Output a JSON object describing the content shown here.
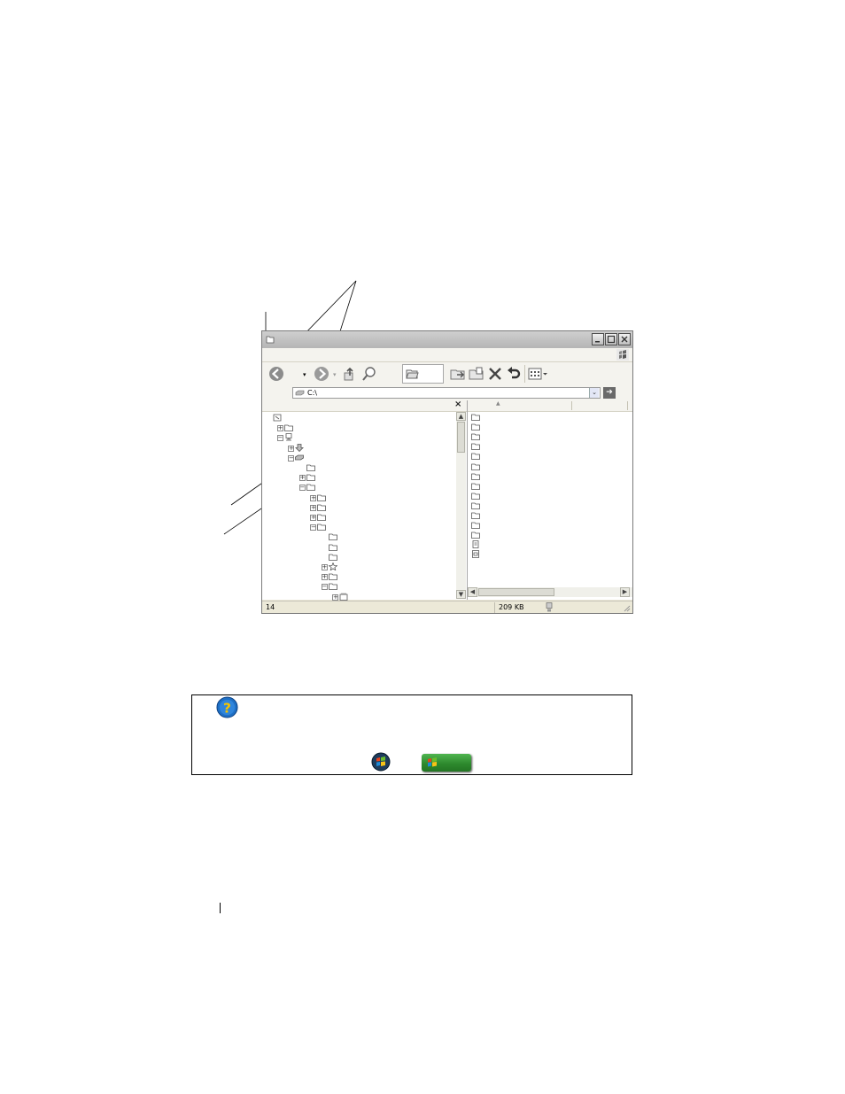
{
  "window": {
    "address_value": "C:\\",
    "close_pane_glyph": "×",
    "status_object_count": "14",
    "status_size": "209 KB"
  },
  "icons": {
    "title": "folder-icon",
    "windows_logo": "windows-flag-icon",
    "back": "back-arrow-icon",
    "forward": "forward-arrow-icon",
    "up": "up-folder-icon",
    "search": "search-icon",
    "folders": "folders-icon",
    "move_to": "move-to-icon",
    "copy_to": "copy-to-icon",
    "delete": "delete-icon",
    "undo": "undo-icon",
    "views": "views-icon",
    "go": "go-arrow-icon",
    "help": "help-question-icon",
    "start_vista": "windows-vista-start-orb-icon",
    "start_xp": "windows-xp-start-button-icon"
  },
  "colors": {
    "help_blue": "#1e6fc4",
    "help_yellow": "#f5c400",
    "xp_start_green": "#2e8a2e"
  }
}
